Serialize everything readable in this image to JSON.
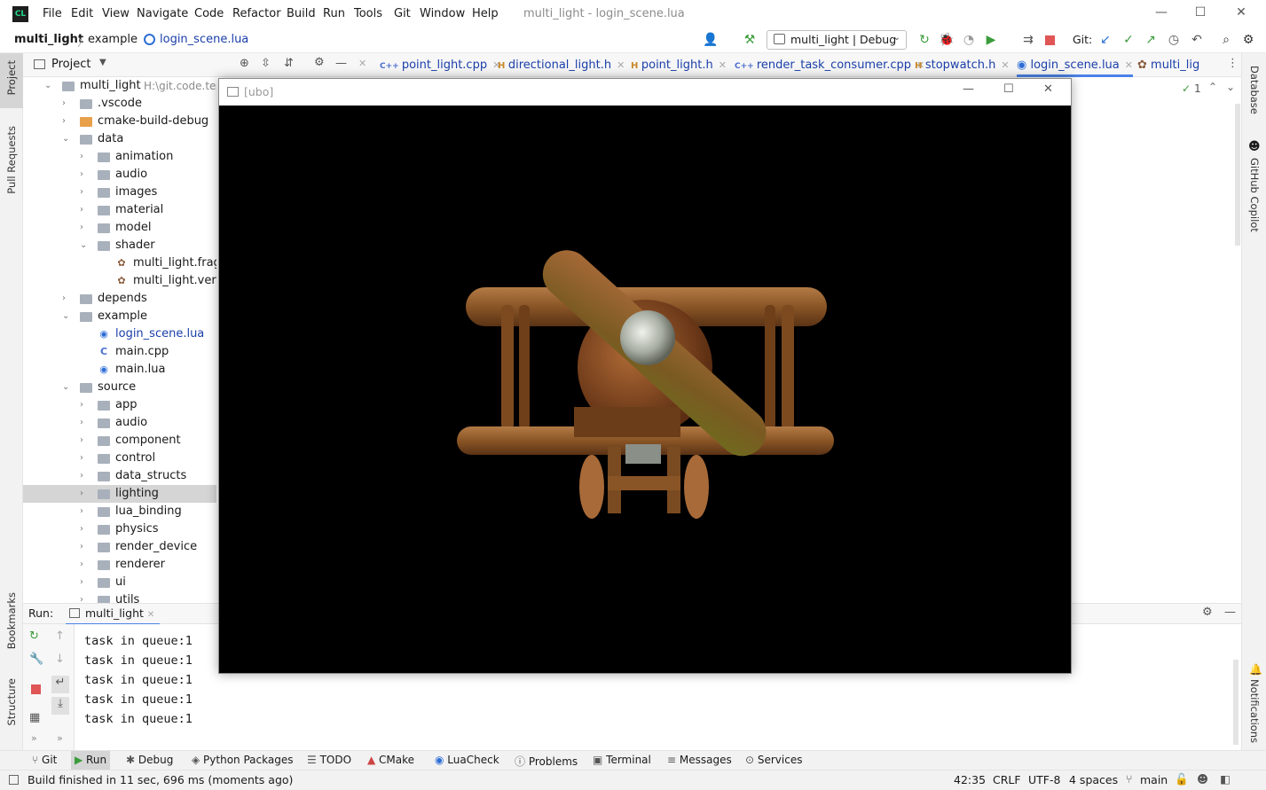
{
  "app": {
    "logo": "CL",
    "menu": [
      "File",
      "Edit",
      "View",
      "Navigate",
      "Code",
      "Refactor",
      "Build",
      "Run",
      "Tools",
      "Git",
      "Window",
      "Help"
    ],
    "window_title": "multi_light - login_scene.lua",
    "controls": {
      "minimize": "—",
      "maximize": "☐",
      "close": "✕"
    }
  },
  "nav": {
    "breadcrumb": [
      "multi_light",
      "example",
      "login_scene.lua"
    ],
    "run_config": "multi_light | Debug",
    "git_label": "Git:"
  },
  "project": {
    "header": "Project",
    "tree": [
      {
        "label": "multi_light",
        "path": "H:\\git.code.tencent",
        "depth": 0,
        "open": true,
        "type": "folder"
      },
      {
        "label": ".vscode",
        "depth": 1,
        "open": false,
        "type": "folder"
      },
      {
        "label": "cmake-build-debug",
        "depth": 1,
        "open": false,
        "type": "folder-orange"
      },
      {
        "label": "data",
        "depth": 1,
        "open": true,
        "type": "folder"
      },
      {
        "label": "animation",
        "depth": 2,
        "open": false,
        "type": "folder"
      },
      {
        "label": "audio",
        "depth": 2,
        "open": false,
        "type": "folder"
      },
      {
        "label": "images",
        "depth": 2,
        "open": false,
        "type": "folder"
      },
      {
        "label": "material",
        "depth": 2,
        "open": false,
        "type": "folder"
      },
      {
        "label": "model",
        "depth": 2,
        "open": false,
        "type": "folder"
      },
      {
        "label": "shader",
        "depth": 2,
        "open": true,
        "type": "folder"
      },
      {
        "label": "multi_light.frag",
        "depth": 3,
        "type": "shader"
      },
      {
        "label": "multi_light.vert",
        "depth": 3,
        "type": "shader"
      },
      {
        "label": "depends",
        "depth": 1,
        "open": false,
        "type": "folder"
      },
      {
        "label": "example",
        "depth": 1,
        "open": true,
        "type": "folder"
      },
      {
        "label": "login_scene.lua",
        "depth": 2,
        "type": "lua",
        "blue": true
      },
      {
        "label": "main.cpp",
        "depth": 2,
        "type": "cpp"
      },
      {
        "label": "main.lua",
        "depth": 2,
        "type": "lua"
      },
      {
        "label": "source",
        "depth": 1,
        "open": true,
        "type": "folder"
      },
      {
        "label": "app",
        "depth": 2,
        "open": false,
        "type": "folder"
      },
      {
        "label": "audio",
        "depth": 2,
        "open": false,
        "type": "folder"
      },
      {
        "label": "component",
        "depth": 2,
        "open": false,
        "type": "folder"
      },
      {
        "label": "control",
        "depth": 2,
        "open": false,
        "type": "folder"
      },
      {
        "label": "data_structs",
        "depth": 2,
        "open": false,
        "type": "folder"
      },
      {
        "label": "lighting",
        "depth": 2,
        "open": false,
        "type": "folder",
        "selected": true
      },
      {
        "label": "lua_binding",
        "depth": 2,
        "open": false,
        "type": "folder"
      },
      {
        "label": "physics",
        "depth": 2,
        "open": false,
        "type": "folder"
      },
      {
        "label": "render_device",
        "depth": 2,
        "open": false,
        "type": "folder"
      },
      {
        "label": "renderer",
        "depth": 2,
        "open": false,
        "type": "folder"
      },
      {
        "label": "ui",
        "depth": 2,
        "open": false,
        "type": "folder"
      },
      {
        "label": "utils",
        "depth": 2,
        "open": false,
        "type": "folder"
      }
    ]
  },
  "tabs": [
    {
      "label": "point_light.cpp",
      "icon": "cpp"
    },
    {
      "label": "directional_light.h",
      "icon": "h"
    },
    {
      "label": "point_light.h",
      "icon": "h"
    },
    {
      "label": "render_task_consumer.cpp",
      "icon": "cpp"
    },
    {
      "label": "stopwatch.h",
      "icon": "h"
    },
    {
      "label": "login_scene.lua",
      "icon": "lua",
      "active": true
    },
    {
      "label": "multi_lig",
      "icon": "shader"
    }
  ],
  "editor": {
    "inspection_count": "1"
  },
  "run": {
    "label": "Run:",
    "config": "multi_light",
    "console": [
      "task in queue:1",
      "task in queue:1",
      "task in queue:1",
      "task in queue:1",
      "task in queue:1"
    ]
  },
  "ubo_window": {
    "title": "[ubo]"
  },
  "side_tools": {
    "left": [
      "Project",
      "Pull Requests",
      "Bookmarks",
      "Structure"
    ],
    "right": [
      "Database",
      "GitHub Copilot",
      "Notifications"
    ]
  },
  "bottom_tabs": [
    "Git",
    "Run",
    "Debug",
    "Python Packages",
    "TODO",
    "CMake",
    "LuaCheck",
    "Problems",
    "Terminal",
    "Messages",
    "Services"
  ],
  "status": {
    "message": "Build finished in 11 sec, 696 ms (moments ago)",
    "position": "42:35",
    "line_sep": "CRLF",
    "encoding": "UTF-8",
    "indent": "4 spaces",
    "branch": "main"
  }
}
